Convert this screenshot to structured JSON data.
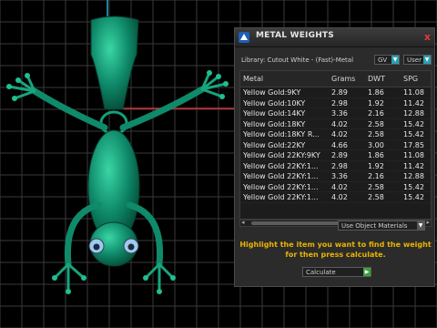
{
  "colors": {
    "viewport_bg": "#000000",
    "grid": "#3a3a3a",
    "frog_green": "#0f8a6a",
    "axis_red": "#d23232",
    "axis_cyan": "#2fa9c9",
    "highlight_text": "#e8b400",
    "dropdown_arrow": "#2a9fb3",
    "calc_arrow": "#3ca23c"
  },
  "panel": {
    "title": "METAL WEIGHTS",
    "close_glyph": "x",
    "library_label": "Library: Cutout White - (Fast)-Metal",
    "gv_dropdown": "GV",
    "user_dropdown": "User",
    "headers": [
      "Metal",
      "Grams",
      "DWT",
      "SPG"
    ],
    "rows": [
      {
        "metal": "Yellow Gold:9KY",
        "grams": "2.89",
        "dwt": "1.86",
        "spg": "11.08",
        "selected": false
      },
      {
        "metal": "Yellow Gold:10KY",
        "grams": "2.98",
        "dwt": "1.92",
        "spg": "11.42",
        "selected": false
      },
      {
        "metal": "Yellow Gold:14KY",
        "grams": "3.36",
        "dwt": "2.16",
        "spg": "12.88",
        "selected": false
      },
      {
        "metal": "Yellow Gold:18KY",
        "grams": "4.02",
        "dwt": "2.58",
        "spg": "15.42",
        "selected": false
      },
      {
        "metal": "Yellow Gold:18KY R...",
        "grams": "4.02",
        "dwt": "2.58",
        "spg": "15.42",
        "selected": false
      },
      {
        "metal": "Yellow Gold:22KY",
        "grams": "4.66",
        "dwt": "3.00",
        "spg": "17.85",
        "selected": false
      },
      {
        "metal": "Yellow Gold 22KY:9KY",
        "grams": "2.89",
        "dwt": "1.86",
        "spg": "11.08",
        "selected": false
      },
      {
        "metal": "Yellow Gold 22KY:1...",
        "grams": "2.98",
        "dwt": "1.92",
        "spg": "11.42",
        "selected": false
      },
      {
        "metal": "Yellow Gold 22KY:1...",
        "grams": "3.36",
        "dwt": "2.16",
        "spg": "12.88",
        "selected": false
      },
      {
        "metal": "Yellow Gold 22KY:1...",
        "grams": "4.02",
        "dwt": "2.58",
        "spg": "15.42",
        "selected": false
      },
      {
        "metal": "Yellow Gold 22KY:1...",
        "grams": "4.02",
        "dwt": "2.58",
        "spg": "15.42",
        "selected": false
      }
    ],
    "use_object_materials": "Use Object Materials",
    "instruction_line1": "Highlight the item you want to find the weight",
    "instruction_line2": "for then press calculate.",
    "calculate_label": "Calculate"
  }
}
